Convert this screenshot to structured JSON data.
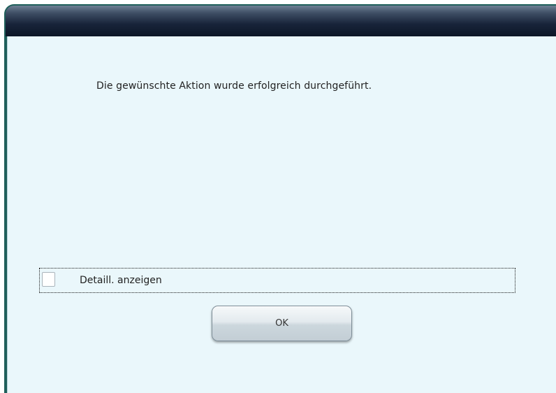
{
  "dialog": {
    "message": "Die gewünschte Aktion wurde erfolgreich durchgeführt.",
    "details_checkbox": {
      "label": "Detaill. anzeigen",
      "checked": false
    },
    "ok_button_label": "OK"
  },
  "colors": {
    "window_frame": "#1f5f5a",
    "title_bar_dark": "#0c1626",
    "content_background": "#eaf7fb"
  }
}
